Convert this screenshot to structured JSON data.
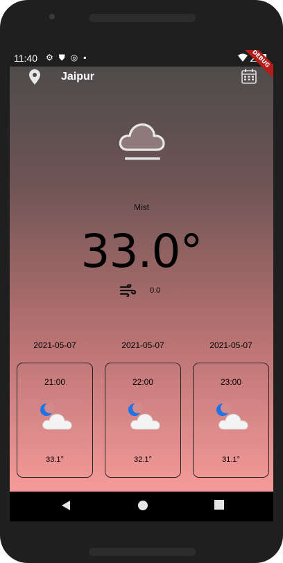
{
  "status_bar": {
    "time": "11:40",
    "debug_label": "DEBUG"
  },
  "app_bar": {
    "city": "Jaipur"
  },
  "current": {
    "condition": "Mist",
    "temperature": "33.0°",
    "wind": "0.0"
  },
  "forecast": [
    {
      "date": "2021-05-07",
      "time": "21:00",
      "temp": "33.1°",
      "icon": "night-partly-cloudy-icon"
    },
    {
      "date": "2021-05-07",
      "time": "22:00",
      "temp": "32.1°",
      "icon": "night-partly-cloudy-icon"
    },
    {
      "date": "2021-05-07",
      "time": "23:00",
      "temp": "31.1°",
      "icon": "night-partly-cloudy-icon"
    }
  ],
  "colors": {
    "gradient_top": "#4a4a4a",
    "gradient_bottom": "#f59a9a",
    "moon": "#1e73e8",
    "debug_ribbon": "#b71c1c"
  }
}
